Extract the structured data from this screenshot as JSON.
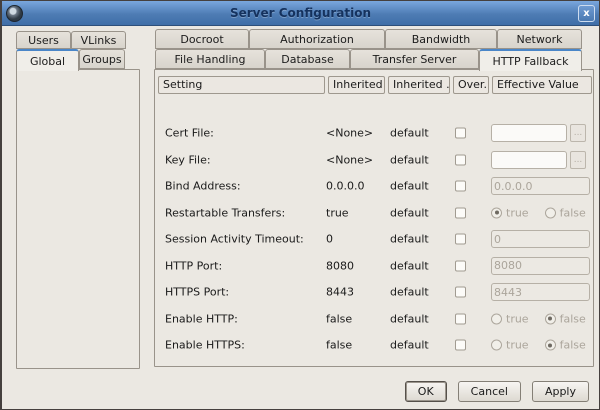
{
  "window": {
    "title": "Server Configuration",
    "close_glyph": "x"
  },
  "left_tabs": {
    "rows": [
      [
        "Users",
        "VLinks"
      ],
      [
        "Global",
        "Groups"
      ]
    ],
    "selected": "Global"
  },
  "right_tabs": {
    "rows": [
      [
        "Docroot",
        "Authorization",
        "Bandwidth",
        "Network"
      ],
      [
        "File Handling",
        "Database",
        "Transfer Server",
        "HTTP Fallback"
      ]
    ],
    "selected": "HTTP Fallback"
  },
  "table": {
    "headers": [
      "Setting",
      "Inherited ...",
      "Inherited ...",
      "Over...",
      "Effective Value"
    ],
    "rows": [
      {
        "label": "Cert File:",
        "inherited": "<None>",
        "source": "default",
        "override": false,
        "control": {
          "type": "file",
          "value": "",
          "browse": "...",
          "enabled": false
        }
      },
      {
        "label": "Key File:",
        "inherited": "<None>",
        "source": "default",
        "override": false,
        "control": {
          "type": "file",
          "value": "",
          "browse": "...",
          "enabled": false
        }
      },
      {
        "label": "Bind Address:",
        "inherited": "0.0.0.0",
        "source": "default",
        "override": false,
        "control": {
          "type": "text",
          "value": "0.0.0.0",
          "enabled": false
        }
      },
      {
        "label": "Restartable Transfers:",
        "inherited": "true",
        "source": "default",
        "override": false,
        "control": {
          "type": "radio",
          "options": [
            "true",
            "false"
          ],
          "selected": "true",
          "enabled": false
        }
      },
      {
        "label": "Session Activity Timeout:",
        "inherited": "0",
        "source": "default",
        "override": false,
        "control": {
          "type": "text",
          "value": "0",
          "enabled": false
        }
      },
      {
        "label": "HTTP Port:",
        "inherited": "8080",
        "source": "default",
        "override": false,
        "control": {
          "type": "text",
          "value": "8080",
          "enabled": false
        }
      },
      {
        "label": "HTTPS Port:",
        "inherited": "8443",
        "source": "default",
        "override": false,
        "control": {
          "type": "text",
          "value": "8443",
          "enabled": false
        }
      },
      {
        "label": "Enable HTTP:",
        "inherited": "false",
        "source": "default",
        "override": false,
        "control": {
          "type": "radio",
          "options": [
            "true",
            "false"
          ],
          "selected": "false",
          "enabled": false
        }
      },
      {
        "label": "Enable HTTPS:",
        "inherited": "false",
        "source": "default",
        "override": false,
        "control": {
          "type": "radio",
          "options": [
            "true",
            "false"
          ],
          "selected": "false",
          "enabled": false
        }
      }
    ]
  },
  "footer": {
    "ok": "OK",
    "cancel": "Cancel",
    "apply": "Apply"
  },
  "colors": {
    "titlebar_top": "#7aa7de",
    "titlebar_bottom": "#3f6ea7",
    "title_text": "#15325e",
    "tab_accent": "#4a86c8",
    "window_bg": "#ebe8e2"
  }
}
